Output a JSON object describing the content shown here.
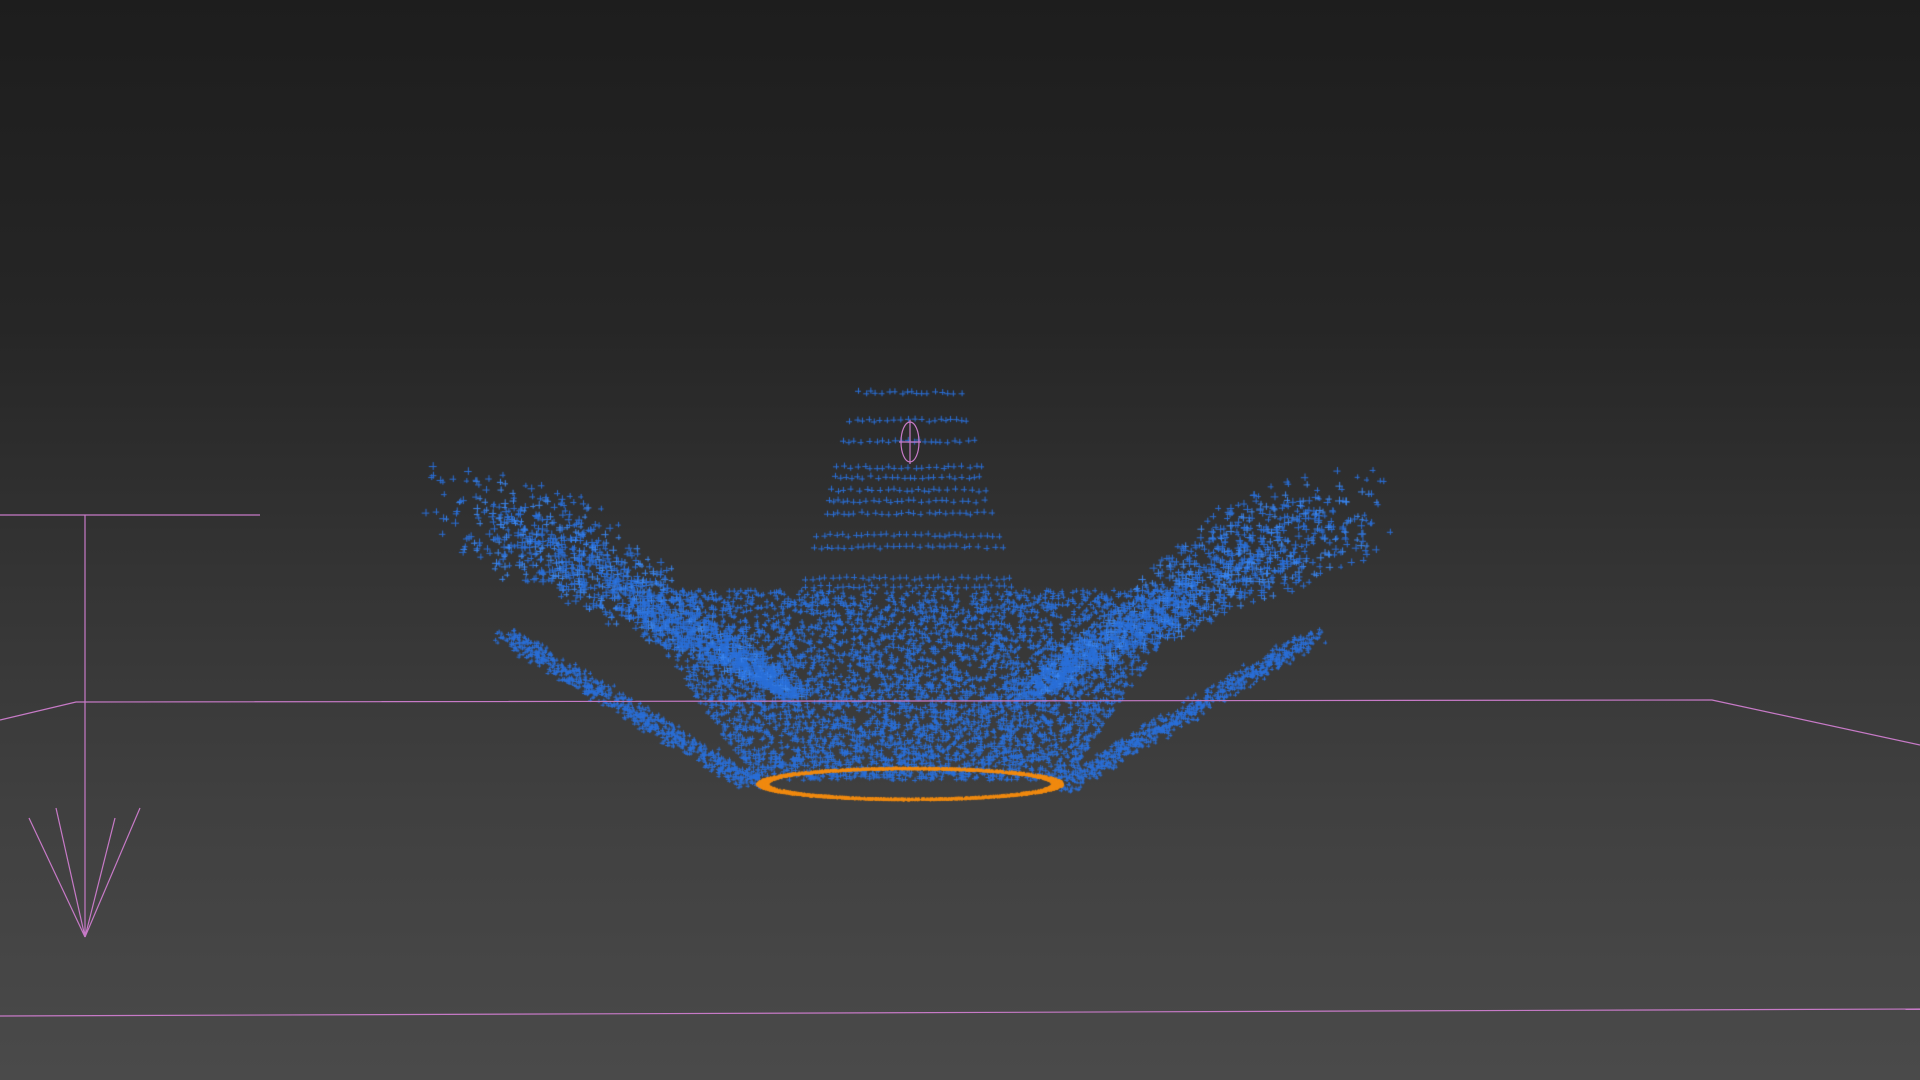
{
  "viewport": {
    "colors": {
      "particle": "#2a6fd8",
      "particle_bright": "#3a86f0",
      "ring": "#f08a10",
      "helper": "#c77ac7",
      "bg_top": "#1d1d1d",
      "bg_bottom": "#4a4a4a"
    }
  }
}
